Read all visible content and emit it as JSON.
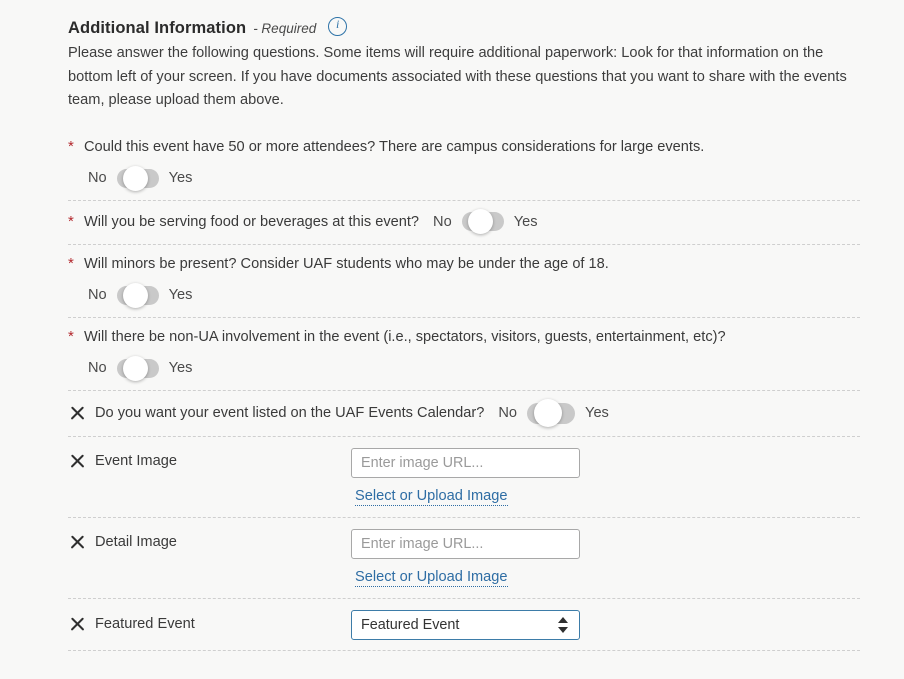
{
  "section": {
    "title": "Additional Information",
    "required_note": "- Required",
    "info_icon": "info-circle-icon",
    "description": "Please answer the following questions. Some items will require additional paperwork: Look for that information on the bottom left of your screen. If you have documents associated with these questions that you want to share with the events team, please upload them above."
  },
  "toggle": {
    "off_label": "No",
    "on_label": "Yes"
  },
  "questions": [
    {
      "marker": "*",
      "text": "Could this event have 50 or more attendees? There are campus considerations for large events.",
      "layout": "stacked",
      "value": "No"
    },
    {
      "marker": "*",
      "text": "Will you be serving food or beverages at this event?",
      "layout": "inline",
      "value": "No"
    },
    {
      "marker": "*",
      "text": "Will minors be present? Consider UAF students who may be under the age of 18.",
      "layout": "stacked",
      "value": "No"
    },
    {
      "marker": "*",
      "text": "Will there be non-UA involvement in the event (i.e., spectators, visitors, guests, entertainment, etc)?",
      "layout": "stacked",
      "value": "No"
    },
    {
      "marker": "x",
      "text": "Do you want your event listed on the UAF Events Calendar?",
      "layout": "inline",
      "value": "No"
    }
  ],
  "image_fields": [
    {
      "marker": "x",
      "label": "Event Image",
      "input_value": "",
      "input_placeholder": "Enter image URL...",
      "link_label": "Select or Upload Image"
    },
    {
      "marker": "x",
      "label": "Detail Image",
      "input_value": "",
      "input_placeholder": "Enter image URL...",
      "link_label": "Select or Upload Image"
    }
  ],
  "featured_event": {
    "marker": "x",
    "label": "Featured Event",
    "selected": "Featured Event"
  },
  "colors": {
    "background": "#f8f8f7",
    "required_star": "#b3292e",
    "link": "#2e6da4",
    "select_border": "#3d7ca8",
    "info_icon": "#2e73a8"
  }
}
